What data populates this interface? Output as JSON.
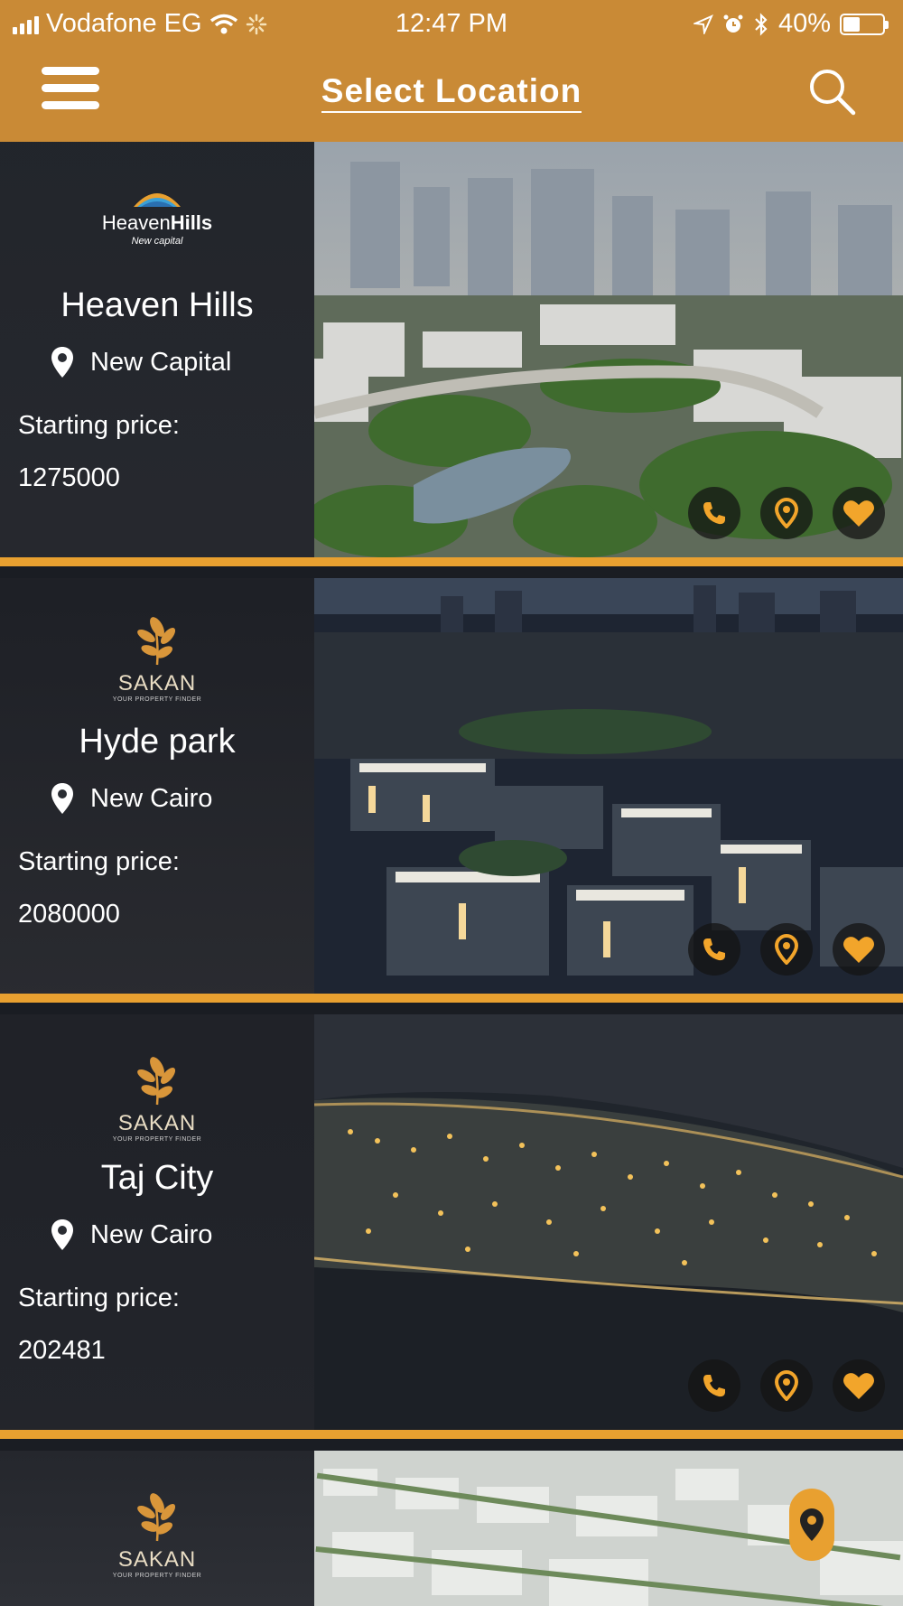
{
  "status_bar": {
    "carrier": "Vodafone EG",
    "time": "12:47 PM",
    "battery": "40%"
  },
  "nav": {
    "title": "Select Location"
  },
  "colors": {
    "accent": "#c98a36",
    "divider": "#e8a030",
    "icon": "#f2a52b"
  },
  "listings": [
    {
      "logo_line1": "Heaven",
      "logo_line2": "Hills",
      "logo_sub": "New capital",
      "name": "Heaven Hills",
      "location": "New Capital",
      "price_label": "Starting price:",
      "price": "1275000"
    },
    {
      "logo_text": "SAKAN",
      "logo_sub": "YOUR PROPERTY FINDER",
      "name": "Hyde park",
      "location": "New Cairo",
      "price_label": "Starting price:",
      "price": "2080000"
    },
    {
      "logo_text": "SAKAN",
      "logo_sub": "YOUR PROPERTY FINDER",
      "name": "Taj City",
      "location": "New Cairo",
      "price_label": "Starting price:",
      "price": "202481"
    },
    {
      "logo_text": "SAKAN",
      "logo_sub": "YOUR PROPERTY FINDER"
    }
  ]
}
